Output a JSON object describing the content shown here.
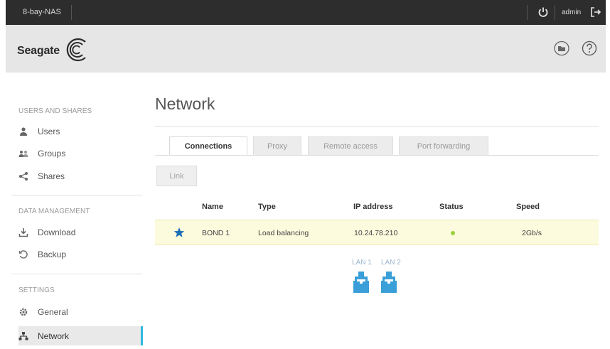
{
  "topbar": {
    "device_name": "8-bay-NAS",
    "user": "admin",
    "icons": [
      "power-icon",
      "logout-icon"
    ]
  },
  "header": {
    "brand": "Seagate",
    "icons": [
      "seagate-logo-icon",
      "folder-icon",
      "help-icon"
    ]
  },
  "sidebar": {
    "sections": [
      {
        "title": "USERS AND SHARES",
        "items": [
          {
            "label": "Users",
            "icon": "user-icon"
          },
          {
            "label": "Groups",
            "icon": "groups-icon"
          },
          {
            "label": "Shares",
            "icon": "share-icon"
          }
        ]
      },
      {
        "title": "DATA MANAGEMENT",
        "items": [
          {
            "label": "Download",
            "icon": "download-icon"
          },
          {
            "label": "Backup",
            "icon": "backup-icon"
          }
        ]
      },
      {
        "title": "SETTINGS",
        "items": [
          {
            "label": "General",
            "icon": "gear-icon"
          },
          {
            "label": "Network",
            "icon": "network-icon",
            "active": true
          }
        ]
      }
    ]
  },
  "main": {
    "title": "Network",
    "tabs": [
      {
        "label": "Connections",
        "active": true
      },
      {
        "label": "Proxy"
      },
      {
        "label": "Remote access"
      },
      {
        "label": "Port forwarding"
      }
    ],
    "link_button": "Link",
    "table": {
      "columns": [
        "Name",
        "Type",
        "IP address",
        "Status",
        "Speed"
      ],
      "rows": [
        {
          "name": "BOND 1",
          "type": "Load balancing",
          "ip": "10.24.78.210",
          "status": "connected",
          "speed": "2Gb/s",
          "default": true
        }
      ]
    },
    "lan_ports": [
      "LAN 1",
      "LAN 2"
    ]
  },
  "colors": {
    "accent": "#2fb8e0",
    "topbar_bg": "#2d2d2d",
    "header_bg": "#e6e6e6",
    "row_highlight": "#fdfbdd",
    "status_ok": "#9bd13a",
    "star": "#1f6fb6",
    "lan_icon": "#3a9fd8"
  }
}
